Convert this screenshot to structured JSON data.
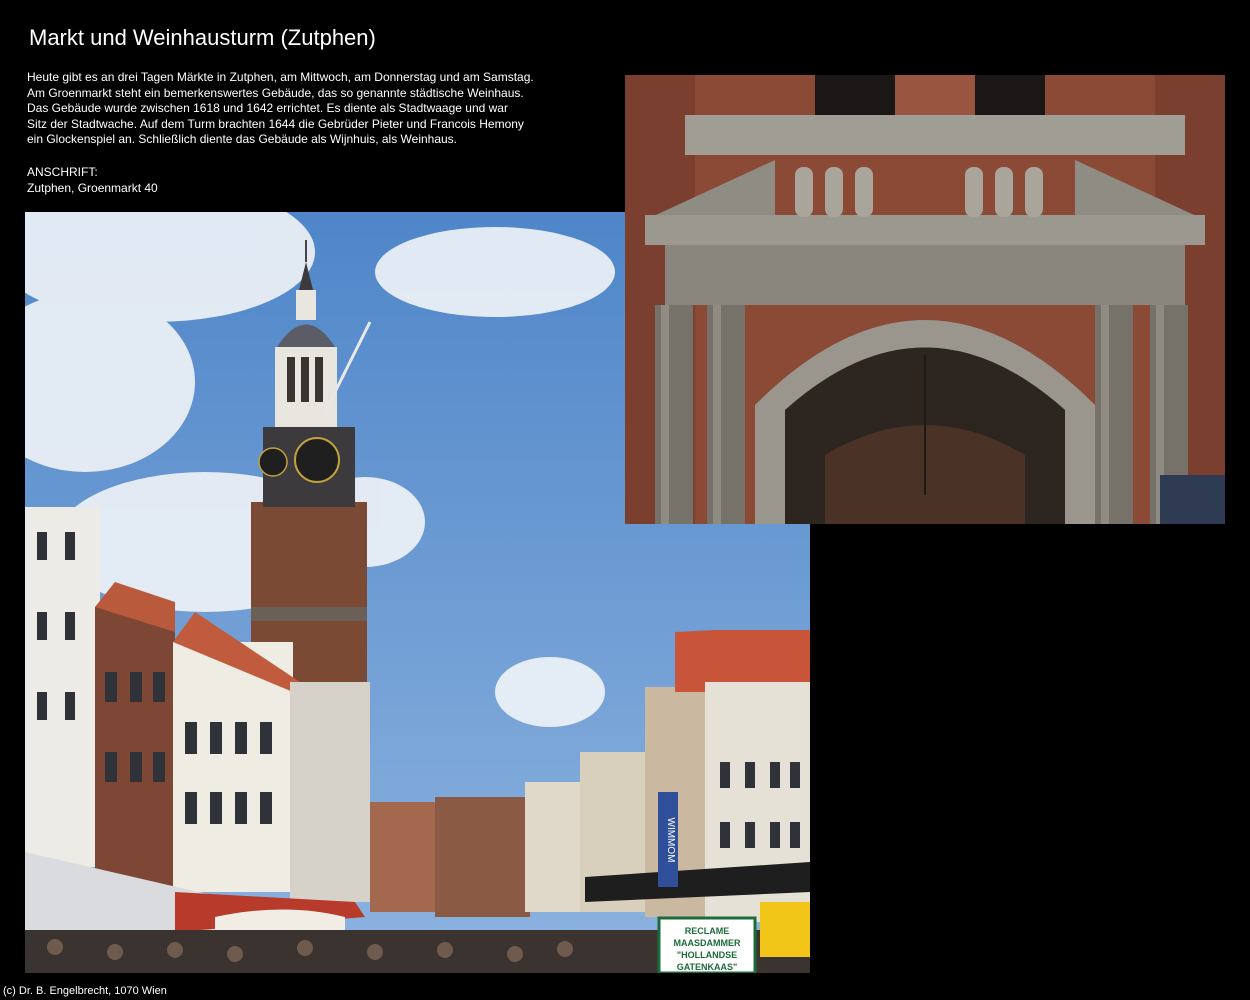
{
  "page": {
    "title": "Markt und Weinhausturm (Zutphen)",
    "description": [
      "Heute gibt es an drei Tagen Märkte in Zutphen, am Mittwoch, am Donnerstag und am Samstag.",
      "Am Groenmarkt steht ein bemerkenswertes Gebäude, das so genannte städtische Weinhaus.",
      "Das Gebäude wurde zwischen 1618 und 1642 errichtet. Es diente als Stadtwaage und war",
      "Sitz der Stadtwache. Auf dem Turm brachten 1644 die Gebrüder Pieter und Francois Hemony",
      "ein Glockenspiel an. Schließlich diente das Gebäude als Wijnhuis, als Weinhaus."
    ],
    "address_label": "ANSCHRIFT:",
    "address_value": "Zutphen, Groenmarkt 40",
    "footer": "(c) Dr. B. Engelbrecht, 1070 Wien"
  },
  "photos": {
    "market_signs": {
      "sign_top": "RECLAME",
      "sign_line1": "MAASDAMMER",
      "sign_line2": "\"HOLLANDSE",
      "sign_line3": "GATENKAAS\"",
      "banner": "WIMMOM"
    }
  },
  "colors": {
    "background": "#000000",
    "text": "#ffffff",
    "sky": "#5d8fcc",
    "brick": "#8a4a32",
    "stone": "#8c8a82"
  }
}
